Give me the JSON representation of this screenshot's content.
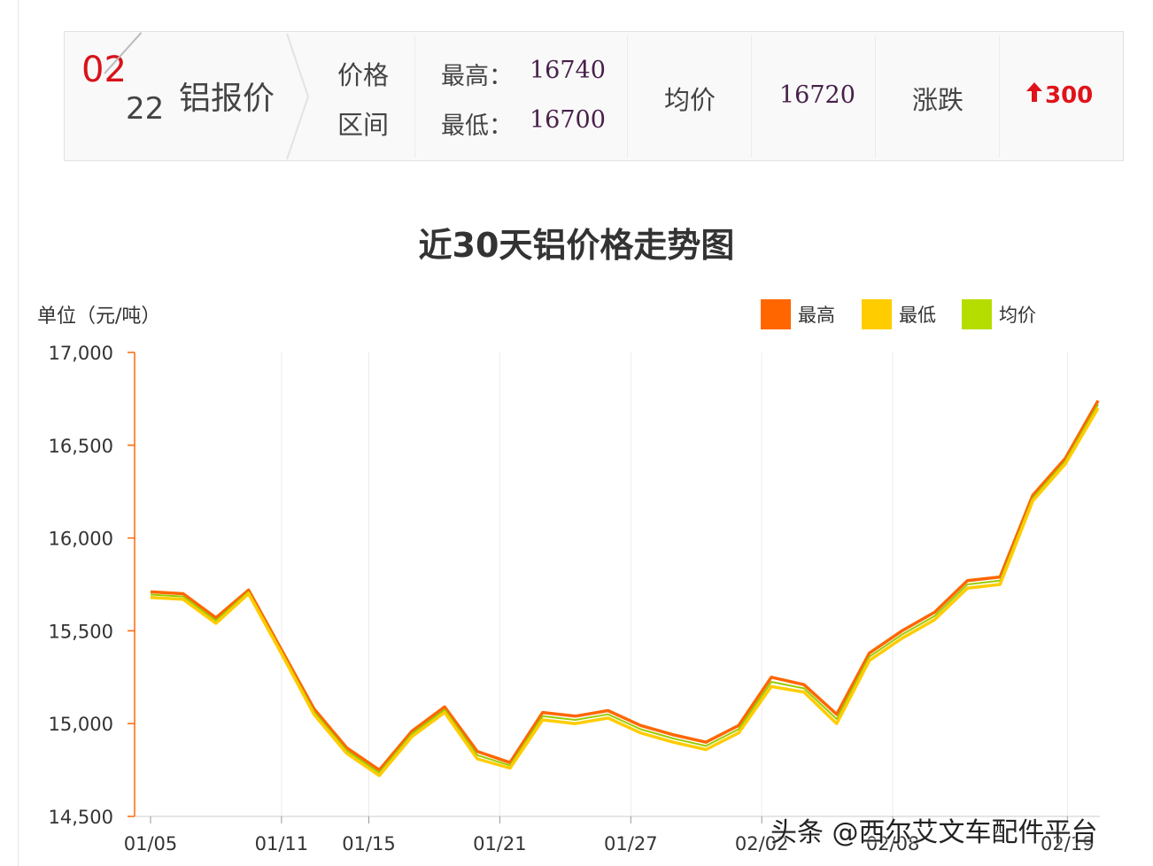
{
  "header": {
    "date_month": "02",
    "date_day": "22",
    "title": "铝报价",
    "range_label_1": "价格",
    "range_label_2": "区间",
    "high_label": "最高：",
    "high_value": "16740",
    "low_label": "最低：",
    "low_value": "16700",
    "avg_label": "均价",
    "avg_value": "16720",
    "change_label": "涨跌",
    "change_value": "300",
    "change_color": "#e0131a"
  },
  "chart_data": {
    "type": "line",
    "title": "近30天铝价格走势图",
    "ylabel": "单位（元/吨）",
    "ylim": [
      14500,
      17000
    ],
    "yticks": [
      "17,000",
      "16,500",
      "16,000",
      "15,500",
      "15,000",
      "14,500"
    ],
    "ytick_values": [
      17000,
      16500,
      16000,
      15500,
      15000,
      14500
    ],
    "x_tick_labels": [
      "01/05",
      "01/11",
      "01/15",
      "01/21",
      "01/27",
      "02/02",
      "02/08",
      "02/19"
    ],
    "x_tick_index": [
      0,
      6,
      10,
      16,
      22,
      28,
      34,
      42
    ],
    "grid": "vertical",
    "legend_placement": "top-right",
    "series": [
      {
        "name": "最高",
        "color": "#ff6600",
        "values": [
          15710,
          15700,
          15570,
          15720,
          15400,
          15080,
          14870,
          14750,
          14960,
          15090,
          14850,
          14790,
          15060,
          15040,
          15070,
          14990,
          14940,
          14900,
          14990,
          15250,
          15210,
          15050,
          15380,
          15500,
          15600,
          15770,
          15790,
          16230,
          16430,
          16740
        ]
      },
      {
        "name": "最低",
        "color": "#ffcc00",
        "values": [
          15680,
          15670,
          15540,
          15700,
          15380,
          15050,
          14840,
          14720,
          14930,
          15060,
          14810,
          14760,
          15020,
          15000,
          15030,
          14950,
          14900,
          14860,
          14950,
          15200,
          15170,
          15000,
          15340,
          15460,
          15560,
          15730,
          15750,
          16200,
          16400,
          16700
        ]
      },
      {
        "name": "均价",
        "color": "#99cc00",
        "values": [
          15695,
          15685,
          15555,
          15710,
          15390,
          15065,
          14855,
          14735,
          14945,
          15075,
          14830,
          14775,
          15040,
          15020,
          15050,
          14970,
          14920,
          14880,
          14970,
          15225,
          15190,
          15025,
          15360,
          15480,
          15580,
          15750,
          15770,
          16215,
          16415,
          16720
        ]
      }
    ]
  },
  "watermark": "头条 @西尔艾文车配件平台"
}
